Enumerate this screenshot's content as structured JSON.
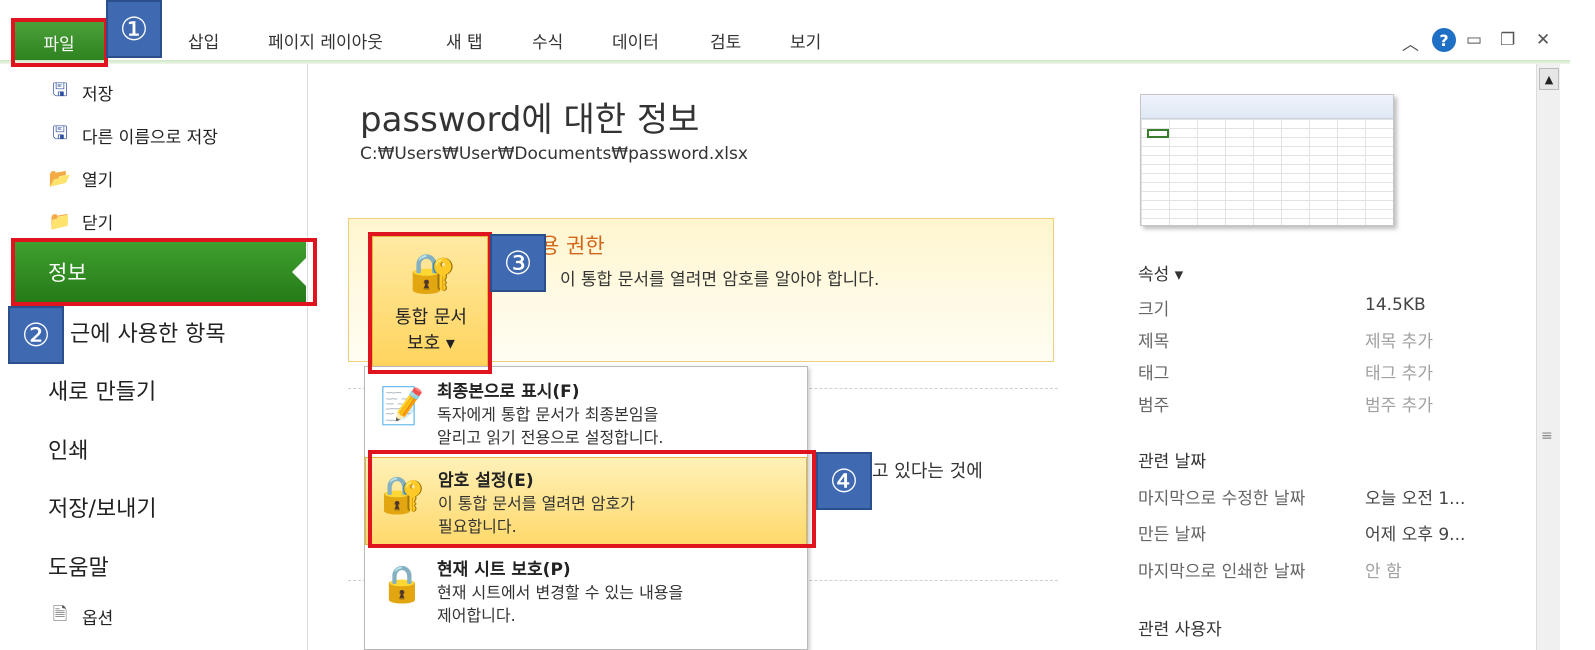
{
  "ribbon": {
    "file_tab": "파일",
    "tabs": [
      "삽입",
      "페이지 레이아웃",
      "새 탭",
      "수식",
      "데이터",
      "검토",
      "보기"
    ],
    "help": "?"
  },
  "nav": {
    "save": "저장",
    "save_as": "다른 이름으로 저장",
    "open": "열기",
    "close": "닫기",
    "info": "정보",
    "recent": "근에 사용한 항목",
    "new": "새로 만들기",
    "print": "인쇄",
    "save_send": "저장/보내기",
    "help": "도움말",
    "options": "옵션"
  },
  "main": {
    "title": "password에 대한 정보",
    "path": "C:₩Users₩User₩Documents₩password.xlsx",
    "permissions_title": "용 권한",
    "permissions_desc": "이 통합 문서를 열려면 암호를 알아야 합니다.",
    "protect_button_line1": "통합 문서",
    "protect_button_line2": "보호 ▾",
    "behind_text": "고 있다는 것에"
  },
  "menu": {
    "items": [
      {
        "title": "최종본으로 표시(F)",
        "desc1": "독자에게 통합 문서가 최종본임을",
        "desc2": "알리고 읽기 전용으로 설정합니다."
      },
      {
        "title": "암호 설정(E)",
        "desc1": "이 통합 문서를 열려면 암호가",
        "desc2": "필요합니다."
      },
      {
        "title": "현재 시트 보호(P)",
        "desc1": "현재 시트에서 변경할 수 있는 내용을",
        "desc2": "제어합니다."
      }
    ]
  },
  "properties": {
    "header": "속성 ▾",
    "rows": [
      {
        "key": "크기",
        "value": "14.5KB"
      },
      {
        "key": "제목",
        "value": "제목 추가"
      },
      {
        "key": "태그",
        "value": "태그 추가"
      },
      {
        "key": "범주",
        "value": "범주 추가"
      }
    ],
    "dates_header": "관련 날짜",
    "dates": [
      {
        "key": "마지막으로 수정한 날짜",
        "value": "오늘 오전 1..."
      },
      {
        "key": "만든 날짜",
        "value": "어제 오후 9..."
      },
      {
        "key": "마지막으로 인쇄한 날짜",
        "value": "안 함"
      }
    ],
    "people_header": "관련 사용자"
  },
  "callouts": [
    "①",
    "②",
    "③",
    "④"
  ],
  "colors": {
    "highlight": "#e0141e",
    "badge": "#3f69b0",
    "file_green": "#2a7f1d"
  }
}
